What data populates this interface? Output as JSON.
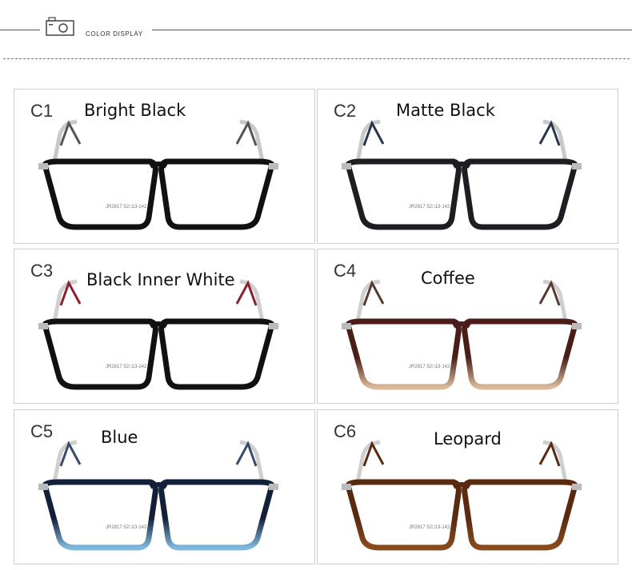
{
  "header": {
    "section_title": "COLOR DISPLAY",
    "icon": "camera-icon"
  },
  "variants": [
    {
      "code": "C1",
      "name": "Bright Black",
      "frame_color": "#111111",
      "lens_tint": "#ffffff",
      "temple_color": "#c9c9c9",
      "temple_accent": "#555555",
      "bottom_color": "#111111"
    },
    {
      "code": "C2",
      "name": "Matte Black",
      "frame_color": "#1d1d22",
      "lens_tint": "#ffffff",
      "temple_color": "#c9c9c9",
      "temple_accent": "#2a3550",
      "bottom_color": "#1d1d22"
    },
    {
      "code": "C3",
      "name": "Black Inner White",
      "frame_color": "#111111",
      "lens_tint": "#ffffff",
      "temple_color": "#d0d0d0",
      "temple_accent": "#8a2030",
      "bottom_color": "#111111"
    },
    {
      "code": "C4",
      "name": "Coffee",
      "frame_color": "#4a1d18",
      "lens_tint": "#ffffff",
      "temple_color": "#cfcfcf",
      "temple_accent": "#5a3a30",
      "bottom_color": "#d9b99a"
    },
    {
      "code": "C5",
      "name": "Blue",
      "frame_color": "#13203a",
      "lens_tint": "#ffffff",
      "temple_color": "#cfcfcf",
      "temple_accent": "#3a4a6a",
      "bottom_color": "#7fb8dd"
    },
    {
      "code": "C6",
      "name": "Leopard",
      "frame_color": "#5a2a10",
      "lens_tint": "#ffffff",
      "temple_color": "#cfcfcf",
      "temple_accent": "#5a2a10",
      "bottom_color": "#8a4a1c"
    }
  ],
  "lens_print": {
    "model": "JR2817",
    "size": "52□13-142"
  }
}
